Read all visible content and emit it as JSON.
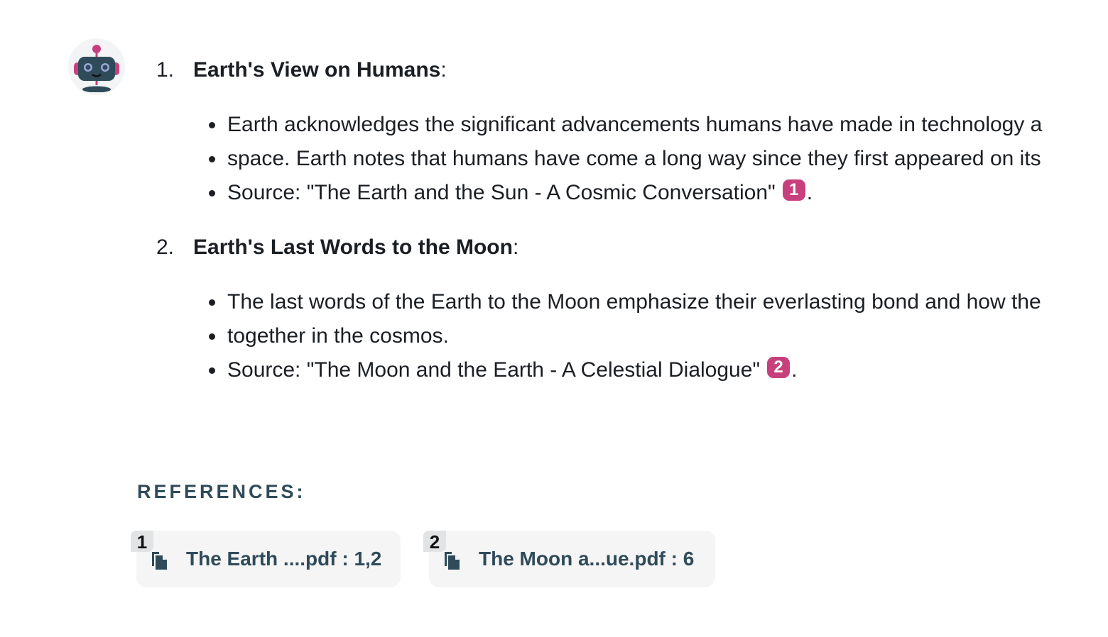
{
  "assistant": {
    "avatar_icon": "robot-icon"
  },
  "message": {
    "sections": [
      {
        "number": "1.",
        "title": "Earth's View on Humans",
        "colon": ":",
        "bullets": [
          {
            "text": "Earth acknowledges the significant advancements humans have made in technology a"
          },
          {
            "text": "space. Earth notes that humans have come a long way since they first appeared on its"
          },
          {
            "text": "Source: \"The Earth and the Sun - A Cosmic Conversation\"",
            "cite": "1",
            "suffix": "."
          }
        ]
      },
      {
        "number": "2.",
        "title": "Earth's Last Words to the Moon",
        "colon": ":",
        "bullets": [
          {
            "text": "The last words of the Earth to the Moon emphasize their everlasting bond and how the"
          },
          {
            "text": "together in the cosmos."
          },
          {
            "text": "Source: \"The Moon and the Earth - A Celestial Dialogue\"",
            "cite": "2",
            "suffix": "."
          }
        ]
      }
    ]
  },
  "references": {
    "title": "REFERENCES:",
    "items": [
      {
        "num": "1",
        "icon": "file-copy-icon",
        "label": "The Earth ....pdf : 1,2"
      },
      {
        "num": "2",
        "icon": "file-copy-icon",
        "label": "The Moon a...ue.pdf : 6"
      }
    ]
  },
  "colors": {
    "cite_bg": "#c7407d",
    "ref_text": "#2f4b5a",
    "card_bg": "#f5f5f6"
  }
}
